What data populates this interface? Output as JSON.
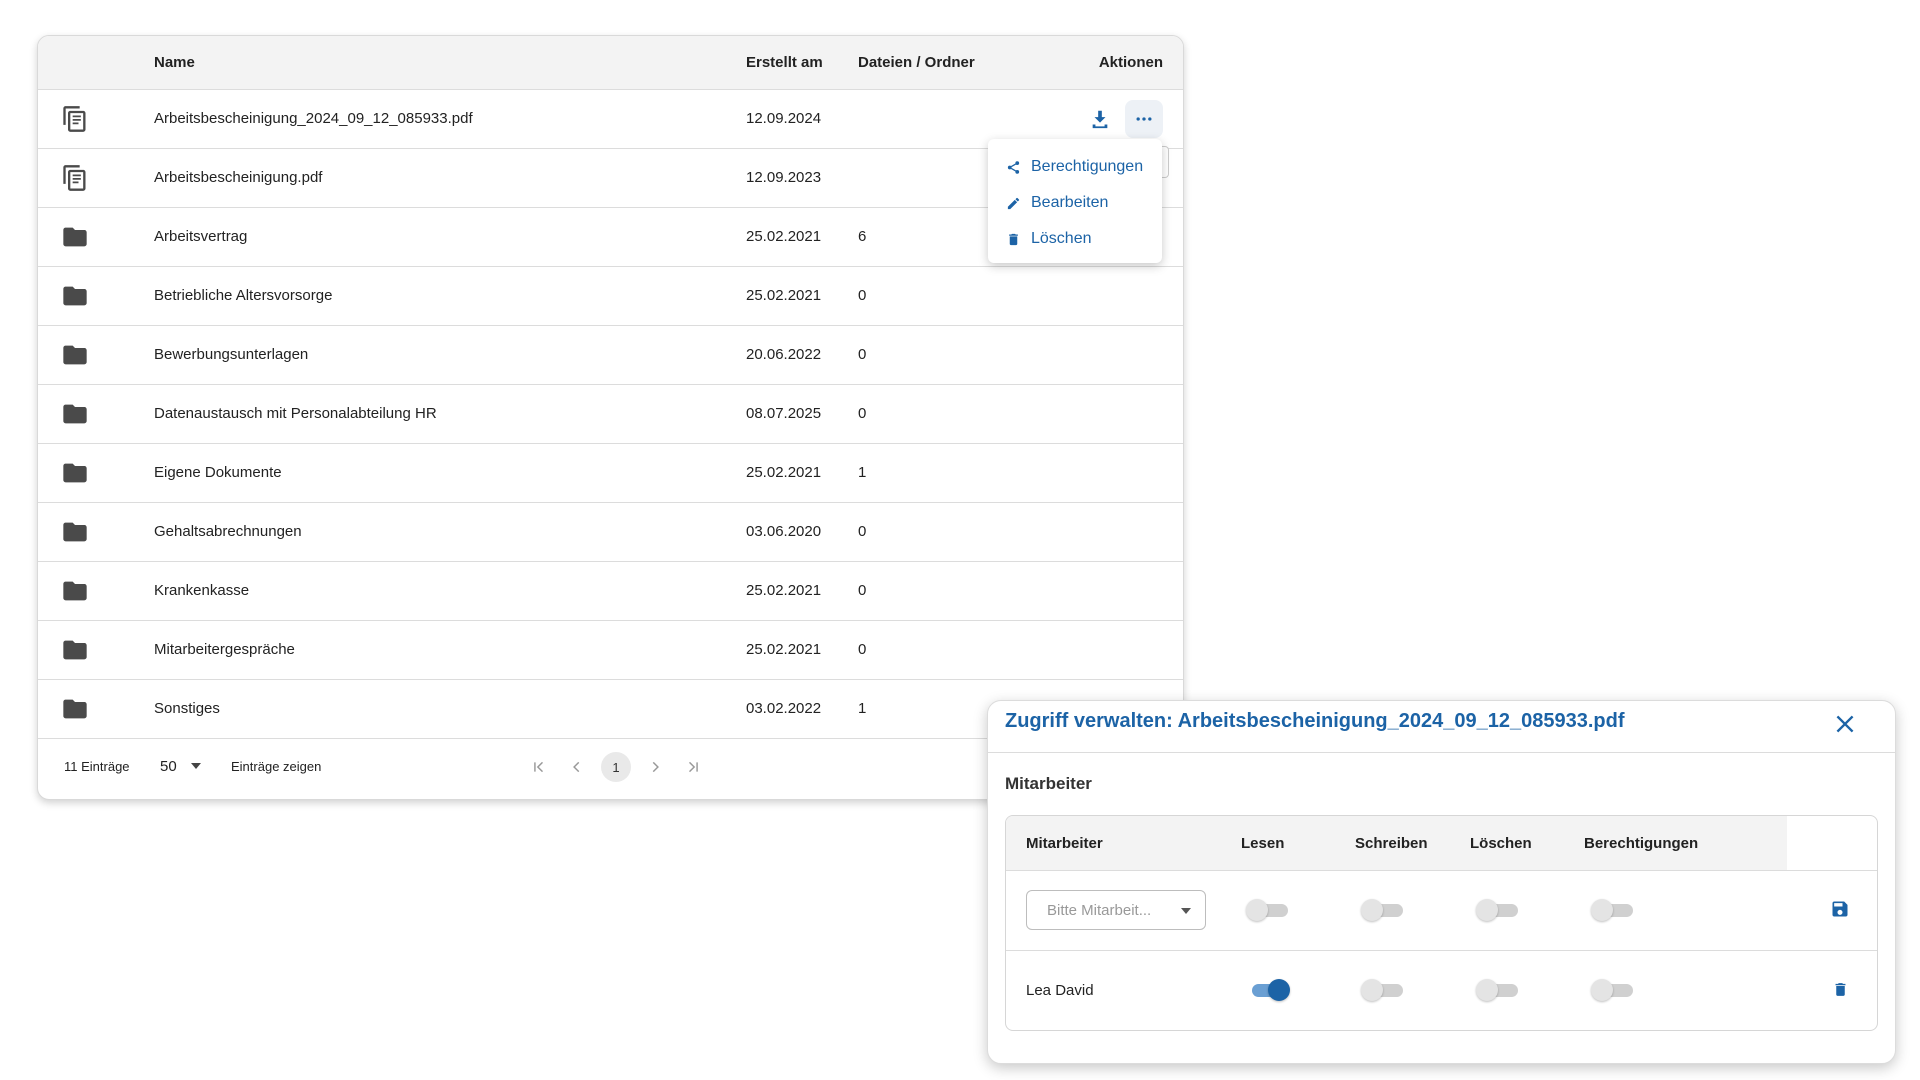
{
  "table": {
    "headers": {
      "name": "Name",
      "created": "Erstellt am",
      "count": "Dateien / Ordner",
      "actions": "Aktionen"
    },
    "rows": [
      {
        "icon": "document-icon",
        "name": "Arbeitsbescheinigung_2024_09_12_085933.pdf",
        "date": "12.09.2024",
        "count": ""
      },
      {
        "icon": "document-icon",
        "name": "Arbeitsbescheinigung.pdf",
        "date": "12.09.2023",
        "count": ""
      },
      {
        "icon": "folder-icon",
        "name": "Arbeitsvertrag",
        "date": "25.02.2021",
        "count": "6"
      },
      {
        "icon": "folder-icon",
        "name": "Betriebliche Altersvorsorge",
        "date": "25.02.2021",
        "count": "0"
      },
      {
        "icon": "folder-icon",
        "name": "Bewerbungsunterlagen",
        "date": "20.06.2022",
        "count": "0"
      },
      {
        "icon": "folder-icon",
        "name": "Datenaustausch mit Personalabteilung HR",
        "date": "08.07.2025",
        "count": "0"
      },
      {
        "icon": "folder-icon",
        "name": "Eigene Dokumente",
        "date": "25.02.2021",
        "count": "1"
      },
      {
        "icon": "folder-icon",
        "name": "Gehaltsabrechnungen",
        "date": "03.06.2020",
        "count": "0"
      },
      {
        "icon": "folder-icon",
        "name": "Krankenkasse",
        "date": "25.02.2021",
        "count": "0"
      },
      {
        "icon": "folder-icon",
        "name": "Mitarbeitergespräche",
        "date": "25.02.2021",
        "count": "0"
      },
      {
        "icon": "folder-icon",
        "name": "Sonstiges",
        "date": "03.02.2022",
        "count": "1"
      }
    ],
    "footer": {
      "entries": "11 Einträge",
      "page_size": "50",
      "page_size_label": "Einträge zeigen",
      "current_page": "1"
    }
  },
  "action_menu": {
    "items": [
      {
        "icon": "share-icon",
        "label": "Berechtigungen"
      },
      {
        "icon": "pencil-icon",
        "label": "Bearbeiten"
      },
      {
        "icon": "trash-icon",
        "label": "Löschen"
      }
    ]
  },
  "dialog": {
    "title": "Zugriff verwalten: Arbeitsbescheinigung_2024_09_12_085933.pdf",
    "section": "Mitarbeiter",
    "columns": {
      "employee": "Mitarbeiter",
      "read": "Lesen",
      "write": "Schreiben",
      "delete": "Löschen",
      "permissions": "Berechtigungen"
    },
    "new_row": {
      "placeholder": "Bitte Mitarbeit...",
      "read": false,
      "write": false,
      "delete": false,
      "permissions": false
    },
    "rows": [
      {
        "employee": "Lea David",
        "read": true,
        "write": false,
        "delete": false,
        "permissions": false
      }
    ]
  },
  "colors": {
    "accent": "#1c63a6",
    "icon": "#4a4a4a",
    "header_bg": "#f3f3f3"
  }
}
